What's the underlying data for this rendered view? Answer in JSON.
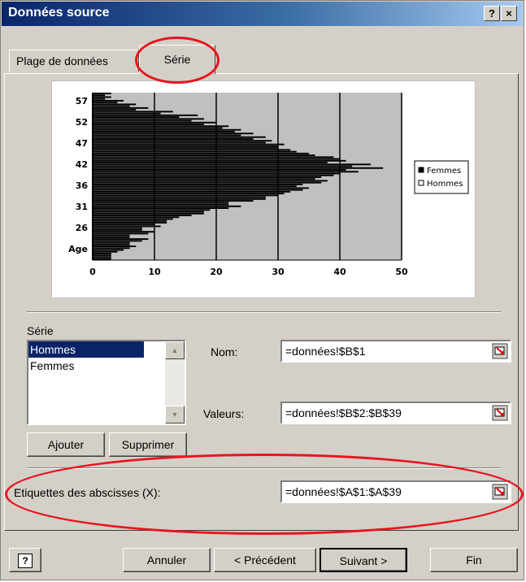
{
  "window": {
    "title": "Données source",
    "help": "?",
    "close": "×"
  },
  "tabs": [
    {
      "label": "Plage de données"
    },
    {
      "label": "Série"
    }
  ],
  "chart_data": {
    "type": "bar",
    "orientation": "horizontal",
    "y_categories": [
      "Age",
      "26",
      "31",
      "36",
      "42",
      "47",
      "52",
      "57"
    ],
    "x_ticks": [
      "0",
      "10",
      "20",
      "30",
      "40",
      "50"
    ],
    "xlim": [
      0,
      50
    ],
    "grid": true,
    "legend": [
      "Femmes",
      "Hommes"
    ],
    "legend_position": "right",
    "series": [
      {
        "name": "Hommes",
        "values": [
          3,
          3,
          5,
          7,
          6,
          9,
          6,
          10,
          8,
          10,
          12,
          14,
          18,
          19,
          24,
          22,
          28,
          30,
          32,
          35,
          34,
          38,
          37,
          40,
          41,
          42,
          38,
          40,
          36,
          33,
          30,
          31,
          29,
          28,
          26,
          24,
          22,
          20,
          18,
          17,
          13,
          9,
          7,
          5,
          3,
          3
        ]
      },
      {
        "name": "Femmes",
        "values": [
          3,
          3,
          4,
          6,
          6,
          8,
          6,
          9,
          8,
          11,
          12,
          13,
          16,
          18,
          22,
          22,
          26,
          28,
          31,
          34,
          33,
          37,
          36,
          39,
          43,
          47,
          45,
          41,
          39,
          35,
          32,
          30,
          28,
          26,
          24,
          23,
          21,
          18,
          16,
          14,
          11,
          7,
          6,
          4,
          2,
          2
        ]
      }
    ],
    "colors": {
      "bars": "#000000",
      "plot_bg": "#c0c0c0"
    }
  },
  "serie": {
    "label": "Série",
    "items": [
      "Hommes",
      "Femmes"
    ],
    "selected": 0,
    "nom_label": "Nom:",
    "nom_value": "=données!$B$1",
    "valeurs_label": "Valeurs:",
    "valeurs_value": "=données!$B$2:$B$39",
    "add": "Ajouter",
    "remove": "Supprimer"
  },
  "abscisses": {
    "label": "Etiquettes des abscisses (X):",
    "value": "=données!$A$1:$A$39"
  },
  "footer": {
    "help": "?",
    "cancel": "Annuler",
    "prev": "< Précédent",
    "next": "Suivant >",
    "finish": "Fin"
  },
  "highlight_color": "#e8141e"
}
